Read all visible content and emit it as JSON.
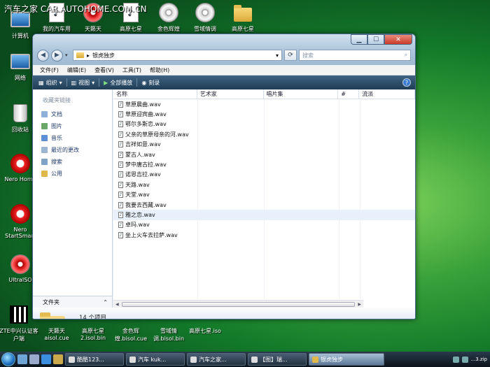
{
  "watermark": "汽车之家  CAR.AUTOHOME.COM.CN",
  "desktop_icons": [
    "计算机",
    "我的汽车用",
    "天籁天",
    "高原七星",
    "金色辉煌",
    "雪域情调",
    "高原七星",
    "网络",
    "回收站",
    "Nero Home",
    "Nero StartSmart",
    "UltraISO",
    "ZTE中兴认证客户端",
    "天籁天aisol.cue",
    "高原七星2.isol.bin",
    "金色辉煌.bisol.cue",
    "雪域情调.bisol.bin",
    "高原七星.iso"
  ],
  "window": {
    "address": "银虎独步",
    "search_placeholder": "搜索",
    "menu": [
      "文件(F)",
      "编辑(E)",
      "查看(V)",
      "工具(T)",
      "帮助(H)"
    ],
    "toolbar": {
      "organize": "组织",
      "views": "视图",
      "play_all": "全部播放",
      "burn": "刻录"
    },
    "sidebar": {
      "title": "收藏夹链接",
      "items": [
        "文档",
        "图片",
        "音乐",
        "最近的更改",
        "搜索",
        "公用"
      ],
      "folders_label": "文件夹"
    },
    "columns": [
      "名称",
      "艺术家",
      "唱片集",
      "#",
      "流派"
    ],
    "files": [
      "草原晨曲.wav",
      "草原迎宾曲.wav",
      "鄂尔多斯恋.wav",
      "父亲的草原母亲的河.wav",
      "吉祥如意.wav",
      "蒙古人.wav",
      "梦中唐古拉.wav",
      "诺恩吉拉.wav",
      "天路.wav",
      "天堂.wav",
      "我要去西藏.wav",
      "雅之恋.wav",
      "卓玛.wav",
      "坐上火车去拉萨.wav"
    ],
    "selected_index": 11,
    "item_count": "14 个项目"
  },
  "taskbar": {
    "tasks": [
      "酷酷123...",
      "汽车 kuk...",
      "汽车之家...",
      "【图】瑞...",
      "银虎独步"
    ],
    "tray_text": "...3.zip"
  }
}
